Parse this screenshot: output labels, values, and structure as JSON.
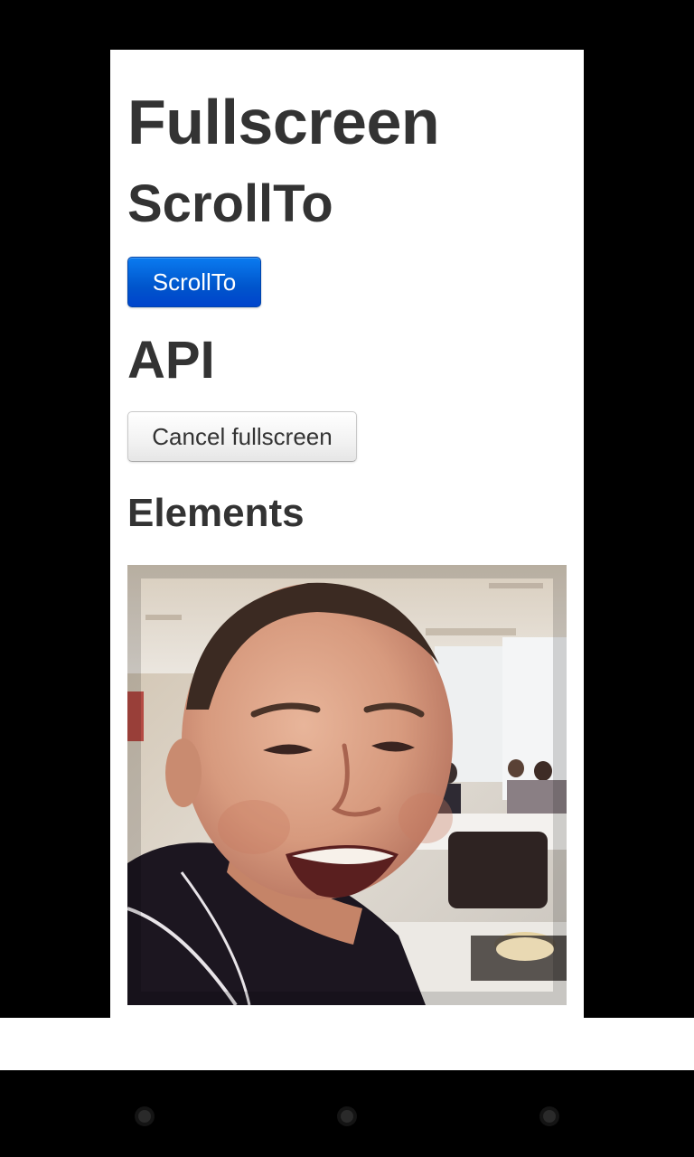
{
  "page": {
    "title": "Fullscreen",
    "scrollto_heading": "ScrollTo",
    "scrollto_button_label": "ScrollTo",
    "api_heading": "API",
    "cancel_button_label": "Cancel fullscreen",
    "elements_heading": "Elements"
  },
  "photo": {
    "icon": "person-photo"
  },
  "navbar": {
    "icons": [
      "back-icon",
      "home-icon",
      "recents-icon"
    ]
  },
  "colors": {
    "primary_button": "#0055cc",
    "heading_text": "#333333",
    "page_background": "#ffffff",
    "outer_background": "#000000"
  }
}
